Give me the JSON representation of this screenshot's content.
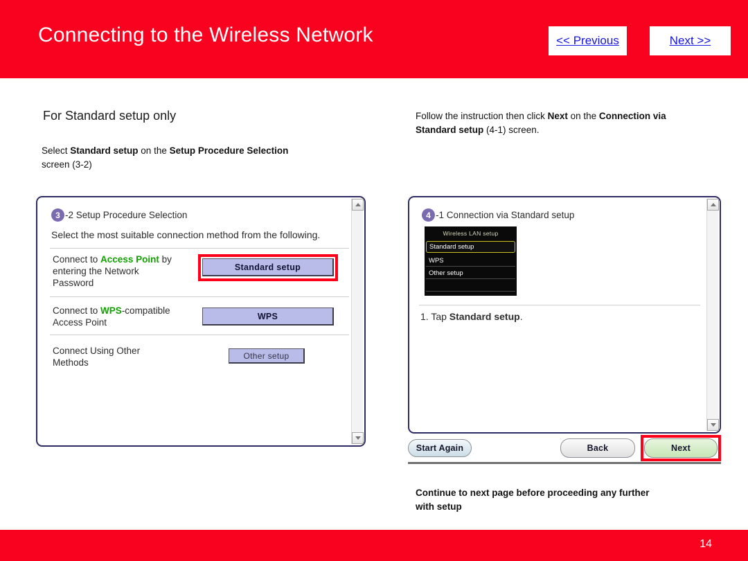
{
  "header": {
    "title": "Connecting to the Wireless Network",
    "previous_label": "<< Previous",
    "next_label": "Next >>",
    "background_color": "#f8021f",
    "link_color": "#1414e0"
  },
  "left_column": {
    "heading": "For Standard setup only",
    "instruction_line1_prefix": "Select ",
    "instruction_bold1": "Standard setup",
    "instruction_mid": " on the ",
    "instruction_bold2": "Setup Procedure Selection",
    "instruction_line2": "screen  (3-2)"
  },
  "right_column": {
    "instruction_prefix": "Follow the instruction then click ",
    "instruction_bold1": "Next",
    "instruction_mid": " on the ",
    "instruction_bold2": "Connection via Standard setup",
    "instruction_suffix": " (4-1) screen.",
    "bottom_note_line1": "Continue to next page before proceeding any further",
    "bottom_note_line2": "with setup"
  },
  "dialog_left": {
    "step_number": "3",
    "step_title": "-2 Setup Procedure Selection",
    "subtitle": "Select the most suitable connection method from the following.",
    "options": [
      {
        "label_part1": "Connect to ",
        "label_green": "Access Point",
        "label_part2": " by",
        "label_line2": "entering the Network",
        "label_line3": "Password",
        "button": "Standard setup",
        "highlighted": true
      },
      {
        "label_part1": "Connect to ",
        "label_green": "WPS",
        "label_part2": "-compatible",
        "label_line2": "Access Point",
        "label_line3": "",
        "button": "WPS",
        "highlighted": false
      },
      {
        "label_part1": "Connect Using Other",
        "label_green": "",
        "label_part2": "",
        "label_line2": "Methods",
        "label_line3": "",
        "button": "Other setup",
        "highlighted": false
      }
    ],
    "button_color": "#b9bce8",
    "highlight_color": "#fb0018"
  },
  "dialog_right": {
    "step_number": "4",
    "step_title": "-1 Connection via Standard setup",
    "lcd": {
      "title": "Wireless LAN setup",
      "items": [
        "Standard setup",
        "WPS",
        "Other setup",
        "",
        ""
      ],
      "selected_index": 0,
      "selection_color": "#c9c21a",
      "background_color": "#0a0a0a"
    },
    "step_instruction_prefix": "1. Tap ",
    "step_instruction_bold": "Standard setup",
    "step_instruction_suffix": "."
  },
  "dialog_buttons": {
    "start_again": "Start Again",
    "back": "Back",
    "next": "Next",
    "next_highlighted": true
  },
  "footer": {
    "page_number": "14",
    "background_color": "#f8021f"
  }
}
